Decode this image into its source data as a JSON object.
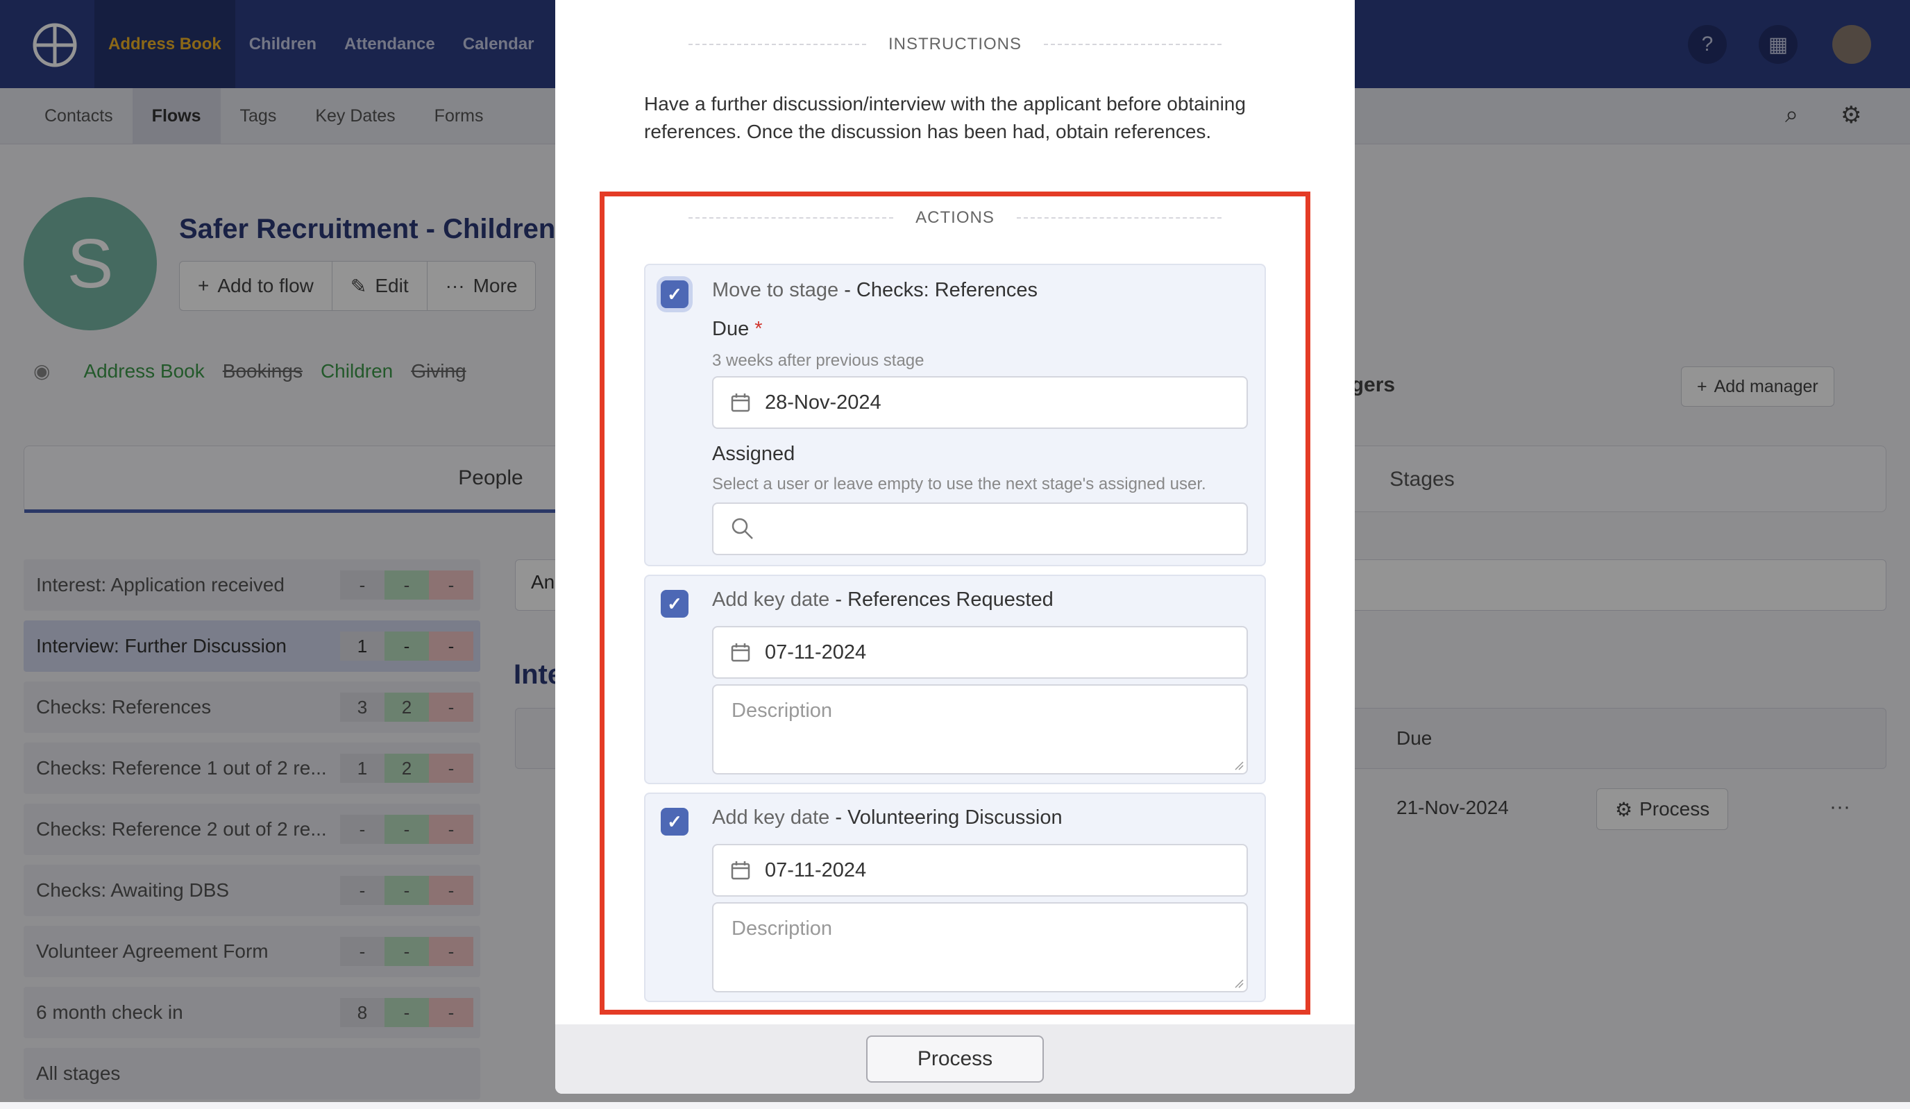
{
  "topnav": {
    "items": [
      "Address Book",
      "Children",
      "Attendance",
      "Calendar"
    ],
    "active": 0
  },
  "subnav": {
    "items": [
      "Contacts",
      "Flows",
      "Tags",
      "Key Dates",
      "Forms"
    ],
    "active": 1
  },
  "flow": {
    "avatar_letter": "S",
    "title": "Safer Recruitment - Children",
    "actions": [
      "Add to flow",
      "Edit",
      "More"
    ],
    "modules": [
      {
        "label": "Address Book",
        "enabled": true
      },
      {
        "label": "Bookings",
        "enabled": false
      },
      {
        "label": "Children",
        "enabled": true
      },
      {
        "label": "Giving",
        "enabled": false
      }
    ]
  },
  "tabs": {
    "people": "People",
    "stages": "Stages"
  },
  "managers": {
    "label": "agers",
    "add_label": "Add manager"
  },
  "stages": [
    {
      "name": "Interest: Application received",
      "count": "-",
      "green": "-",
      "red": "-"
    },
    {
      "name": "Interview: Further Discussion",
      "count": "1",
      "green": "-",
      "red": "-",
      "active": true
    },
    {
      "name": "Checks: References",
      "count": "3",
      "green": "2",
      "red": "-"
    },
    {
      "name": "Checks: Reference 1 out of 2 re...",
      "count": "1",
      "green": "2",
      "red": "-"
    },
    {
      "name": "Checks: Reference 2 out of 2 re...",
      "count": "-",
      "green": "-",
      "red": "-"
    },
    {
      "name": "Checks: Awaiting DBS",
      "count": "-",
      "green": "-",
      "red": "-"
    },
    {
      "name": "Volunteer Agreement Form",
      "count": "-",
      "green": "-",
      "red": "-"
    },
    {
      "name": "6 month check in",
      "count": "8",
      "green": "-",
      "red": "-"
    },
    {
      "name": "All stages"
    }
  ],
  "table": {
    "filter_stub": "An",
    "heading_stub": "Inte",
    "due_header": "Due",
    "row_due": "21-Nov-2024",
    "row_action": "Process"
  },
  "modal": {
    "instructions_heading": "INSTRUCTIONS",
    "instructions": "Have a further discussion/interview with the applicant before obtaining references. Once the discussion has been had, obtain references.",
    "actions_heading": "ACTIONS",
    "move_stage": {
      "prefix": "Move to stage",
      "target": " - Checks: References",
      "due_label": "Due",
      "required_mark": "*",
      "due_hint": "3 weeks after previous stage",
      "due_value": "28-Nov-2024",
      "assigned_label": "Assigned",
      "assigned_hint": "Select a user or leave empty to use the next stage's assigned user.",
      "assigned_value": ""
    },
    "key_date_1": {
      "prefix": "Add key date",
      "name": " - References Requested",
      "date": "07-11-2024",
      "description_placeholder": "Description"
    },
    "key_date_2": {
      "prefix": "Add key date",
      "name": " - Volunteering Discussion",
      "date": "07-11-2024",
      "description_placeholder": "Description"
    },
    "process_label": "Process"
  },
  "colors": {
    "nav": "#2e3f85",
    "accent": "#4d68b5",
    "highlight": "#e43c26",
    "active_nav_text": "#f0b429"
  }
}
